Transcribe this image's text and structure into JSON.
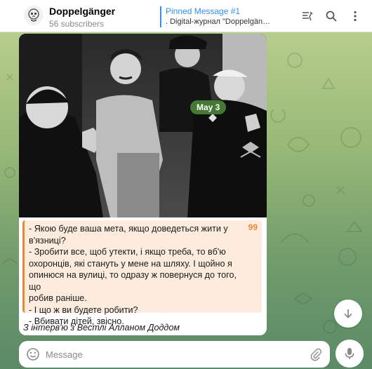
{
  "channel": {
    "name": "Doppelgänger",
    "subscribers": "56 subscribers"
  },
  "pinned": {
    "title": "Pinned Message #1",
    "text": ". Digital-журнал \"Doppelgäng..."
  },
  "header_icons": [
    "pinned-list-icon",
    "search-icon",
    "more-vertical-icon"
  ],
  "message": {
    "date_badge": "May 3",
    "quote_lines": [
      "- Якою буде ваша мета, якщо доведеться жити у",
      "в'язниці?",
      "- Зробити все, щоб утекти, і якщо треба, то вб'ю",
      "охоронців, які стануть у мене на шляху. І щойно я",
      "опинюся на вулиці, то одразу ж повернуся до того, що",
      "робив раніше.",
      "- І що ж ви будете робити?",
      "- Вбивати дітей, звісно."
    ],
    "quote_mark": "99",
    "caption": "З інтерв'ю з Вестлі Алланом Доддом"
  },
  "composer": {
    "placeholder": "Message"
  },
  "colors": {
    "accent": "#3390ec",
    "quote_border": "#e8893a",
    "quote_bg": "#fdecde",
    "date_badge_bg": "#4c8c3c"
  }
}
